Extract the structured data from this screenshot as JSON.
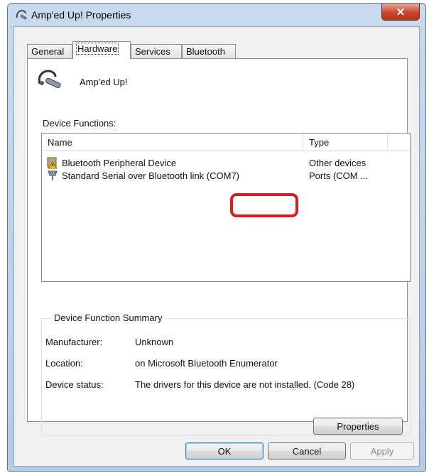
{
  "window": {
    "title": "Amp'ed Up! Properties",
    "close_glyph": "✕"
  },
  "tabs": [
    {
      "label": "General"
    },
    {
      "label": "Hardware"
    },
    {
      "label": "Services"
    },
    {
      "label": "Bluetooth"
    }
  ],
  "active_tab": "Hardware",
  "device": {
    "name": "Amp'ed Up!",
    "icon": "bluetooth-headset-icon"
  },
  "device_functions": {
    "label": "Device Functions:",
    "columns": {
      "name": "Name",
      "type": "Type"
    },
    "rows": [
      {
        "name": "Bluetooth Peripheral Device",
        "type": "Other devices",
        "icon": "warning-device-icon"
      },
      {
        "name": "Standard Serial over Bluetooth link (COM7)",
        "type": "Ports (COM ...",
        "icon": "serial-port-icon"
      }
    ],
    "highlight_color": "#d91c23"
  },
  "summary": {
    "title": "Device Function Summary",
    "manufacturer_label": "Manufacturer:",
    "manufacturer_value": "Unknown",
    "location_label": "Location:",
    "location_value": "on Microsoft Bluetooth Enumerator",
    "status_label": "Device status:",
    "status_value": "The drivers for this device are not installed. (Code 28)",
    "properties_button": "Properties"
  },
  "buttons": {
    "ok": "OK",
    "cancel": "Cancel",
    "apply": "Apply"
  }
}
